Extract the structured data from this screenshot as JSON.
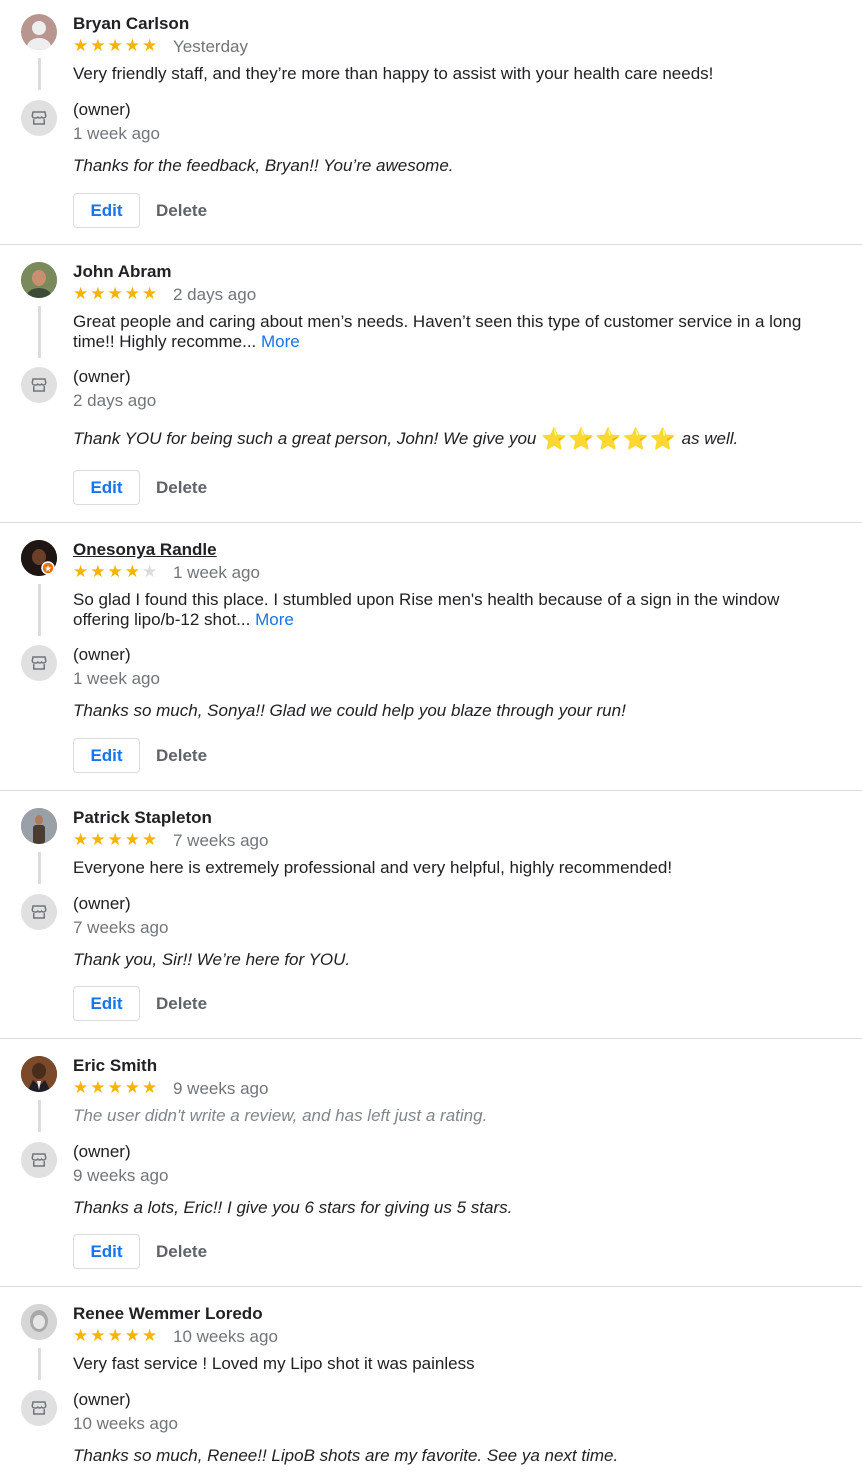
{
  "reviews": [
    {
      "author": "Bryan Carlson",
      "stars": "★★★★★",
      "stars_off": "",
      "rating": 5,
      "date": "Yesterday",
      "text": "Very friendly staff, and they’re more than happy to assist with your health care needs!",
      "more": "",
      "owner_label": "(owner)",
      "owner_date": "1 week ago",
      "reply": "Thanks for the feedback, Bryan!! You’re awesome.",
      "edit_label": "Edit",
      "delete_label": "Delete"
    },
    {
      "author": "John Abram",
      "stars": "★★★★★",
      "stars_off": "",
      "rating": 5,
      "date": "2 days ago",
      "text": "Great people and caring about men’s needs. Haven’t seen this type of customer service in a long time!! Highly recomme...",
      "more": "More",
      "owner_label": "(owner)",
      "owner_date": "2 days ago",
      "reply": "Thank YOU for being such a great person, John! We give you",
      "reply_emoji": "⭐⭐⭐⭐⭐",
      "reply_after": "as well.",
      "edit_label": "Edit",
      "delete_label": "Delete"
    },
    {
      "author": "Onesonya Randle",
      "stars": "★★★★",
      "stars_off": "★",
      "rating": 4,
      "date": "1 week ago",
      "text": "So glad I found this place. I stumbled upon Rise men's health because of a sign in the window offering lipo/b-12 shot...",
      "more": "More",
      "owner_label": "(owner)",
      "owner_date": "1 week ago",
      "reply": "Thanks so much, Sonya!! Glad we could help you blaze through your run!",
      "edit_label": "Edit",
      "delete_label": "Delete"
    },
    {
      "author": "Patrick Stapleton",
      "stars": "★★★★★",
      "stars_off": "",
      "rating": 5,
      "date": "7 weeks ago",
      "text": "Everyone here is extremely professional and very helpful, highly recommended!",
      "more": "",
      "owner_label": "(owner)",
      "owner_date": "7 weeks ago",
      "reply": "Thank you, Sir!! We’re here for YOU.",
      "edit_label": "Edit",
      "delete_label": "Delete"
    },
    {
      "author": "Eric Smith",
      "stars": "★★★★★",
      "stars_off": "",
      "rating": 5,
      "date": "9 weeks ago",
      "text": "The user didn't write a review, and has left just a rating.",
      "more": "",
      "owner_label": "(owner)",
      "owner_date": "9 weeks ago",
      "reply": "Thanks a lots, Eric!! I give you 6 stars for giving us 5 stars.",
      "edit_label": "Edit",
      "delete_label": "Delete"
    },
    {
      "author": "Renee Wemmer Loredo",
      "stars": "★★★★★",
      "stars_off": "",
      "rating": 5,
      "date": "10 weeks ago",
      "text": "Very fast service ! Loved my Lipo shot it was painless",
      "more": "",
      "owner_label": "(owner)",
      "owner_date": "10 weeks ago",
      "reply": "Thanks so much, Renee!! LipoB shots are my favorite. See ya next time."
    }
  ],
  "colors": {
    "star": "#f4b400",
    "link": "#1a73e8",
    "divider": "#dadce0",
    "muted": "#70757a"
  },
  "icons": {
    "owner": "storefront-icon",
    "avatar_default": "person-icon"
  }
}
